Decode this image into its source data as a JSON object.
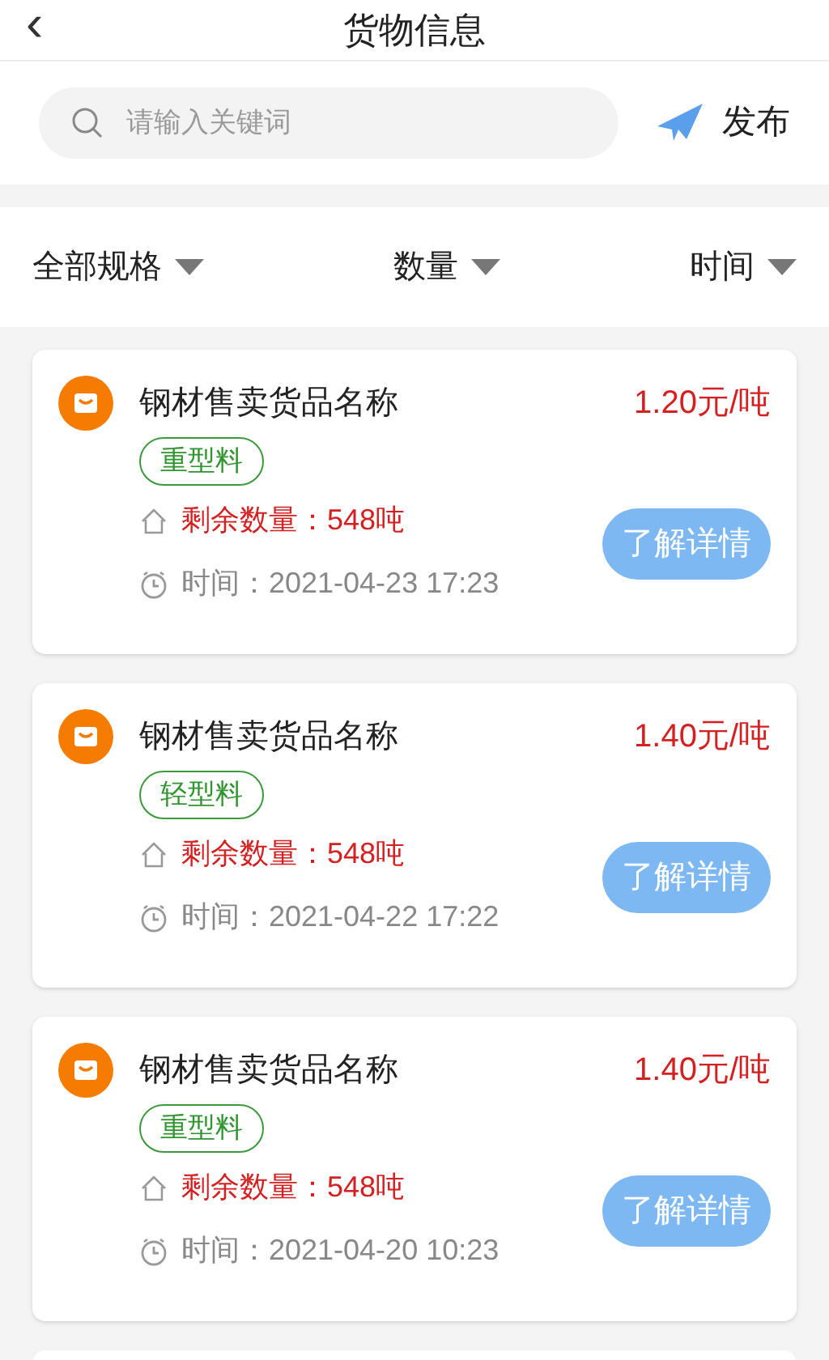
{
  "header": {
    "back": "‹",
    "title": "货物信息"
  },
  "search": {
    "placeholder": "请输入关键词"
  },
  "publish": {
    "label": "发布"
  },
  "filters": [
    {
      "label": "全部规格"
    },
    {
      "label": "数量"
    },
    {
      "label": "时间"
    }
  ],
  "items": [
    {
      "name": "钢材售卖货品名称",
      "price": "1.20元/吨",
      "tag": "重型料",
      "remaining": "剩余数量：548吨",
      "time": "时间：2021-04-23 17:23",
      "button": "了解详情"
    },
    {
      "name": "钢材售卖货品名称",
      "price": "1.40元/吨",
      "tag": "轻型料",
      "remaining": "剩余数量：548吨",
      "time": "时间：2021-04-22 17:22",
      "button": "了解详情"
    },
    {
      "name": "钢材售卖货品名称",
      "price": "1.40元/吨",
      "tag": "重型料",
      "remaining": "剩余数量：548吨",
      "time": "时间：2021-04-20 10:23",
      "button": "了解详情"
    }
  ]
}
